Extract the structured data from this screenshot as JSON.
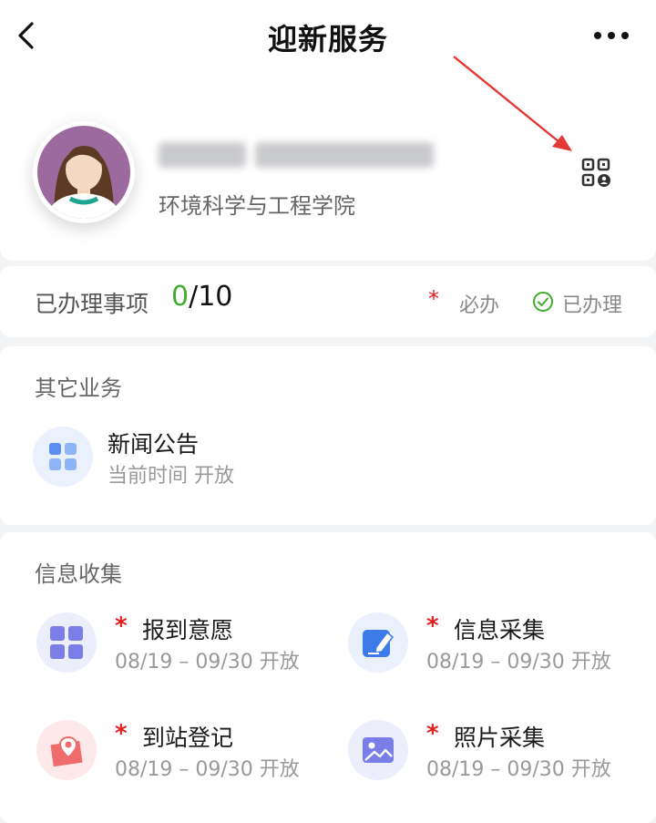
{
  "header": {
    "title": "迎新服务"
  },
  "profile": {
    "college": "环境科学与工程学院"
  },
  "summary": {
    "label": "已办理事项",
    "done_count": "0",
    "total": "/10",
    "legend_required_star": "*",
    "legend_required": "必办",
    "legend_done": "已办理"
  },
  "other_section": {
    "title": "其它业务",
    "items": [
      {
        "name": "新闻公告",
        "sub": "当前时间 开放"
      }
    ]
  },
  "info_section": {
    "title": "信息收集",
    "items": [
      {
        "star": "*",
        "name": "报到意愿",
        "sub": "08/19 – 09/30 开放"
      },
      {
        "star": "*",
        "name": "信息采集",
        "sub": "08/19 – 09/30 开放"
      },
      {
        "star": "*",
        "name": "到站登记",
        "sub": "08/19 – 09/30 开放"
      },
      {
        "star": "*",
        "name": "照片采集",
        "sub": "08/19 – 09/30 开放"
      }
    ]
  },
  "colors": {
    "done_green": "#3fae2a",
    "required_red": "#e02020",
    "arrow_red": "#e53935",
    "icon_blue": "#5b8ef0",
    "icon_purple": "#7a7fe8",
    "icon_red": "#f06b6b"
  },
  "icons": [
    "back-arrow-icon",
    "more-icon",
    "qr-code-icon",
    "check-circle-icon",
    "grid-icon",
    "edit-icon",
    "map-pin-icon",
    "image-icon"
  ]
}
